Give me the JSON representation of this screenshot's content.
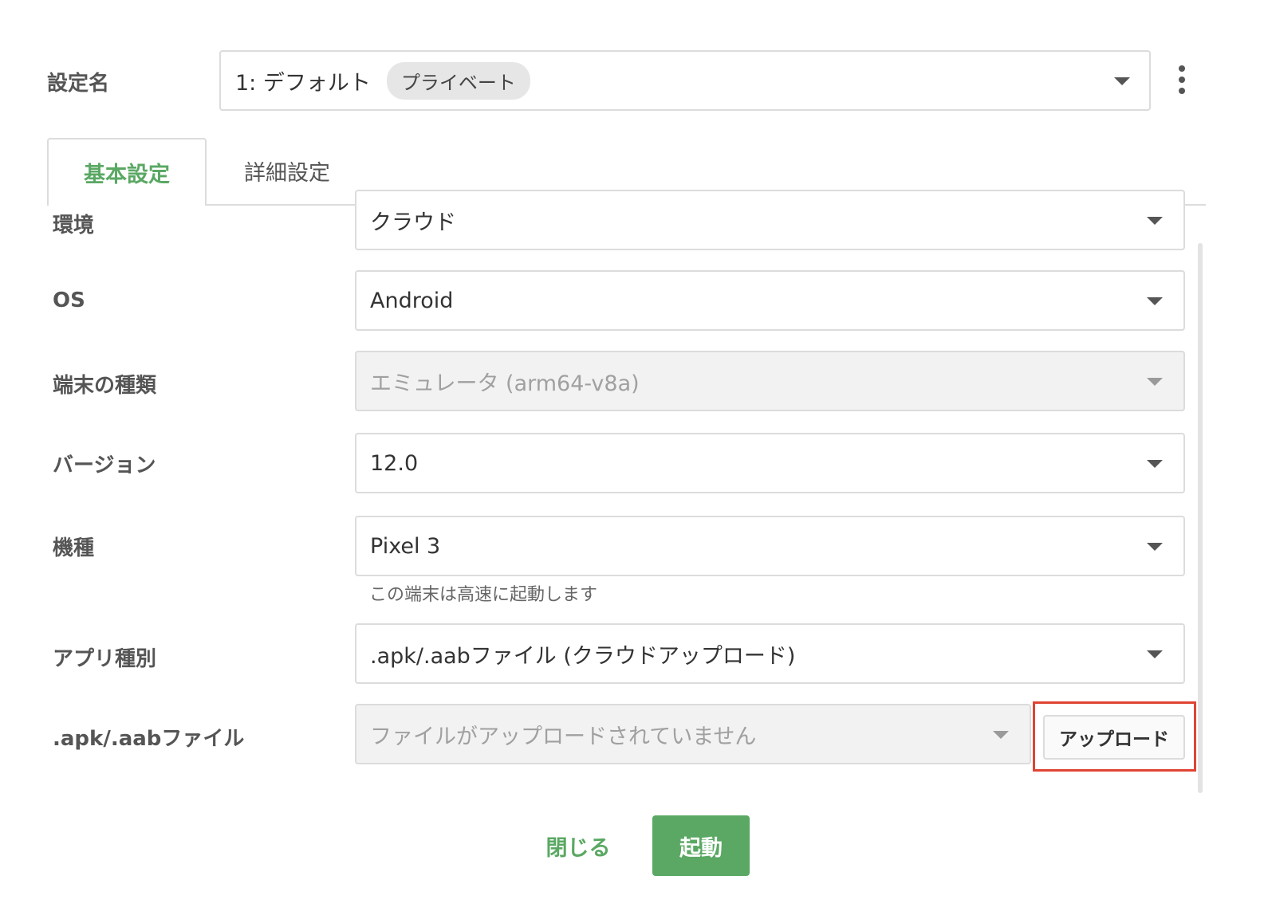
{
  "setting": {
    "label": "設定名",
    "value": "1: デフォルト",
    "badge": "プライベート"
  },
  "tabs": [
    {
      "label": "基本設定",
      "active": true
    },
    {
      "label": "詳細設定",
      "active": false
    }
  ],
  "form": {
    "environment": {
      "label": "環境",
      "value": "クラウド"
    },
    "os": {
      "label": "OS",
      "value": "Android"
    },
    "device_type": {
      "label": "端末の種類",
      "value": "エミュレータ (arm64-v8a)"
    },
    "version": {
      "label": "バージョン",
      "value": "12.0"
    },
    "model": {
      "label": "機種",
      "value": "Pixel 3",
      "hint": "この端末は高速に起動します"
    },
    "app_type": {
      "label": "アプリ種別",
      "value": ".apk/.aabファイル (クラウドアップロード)"
    },
    "app_file": {
      "label": ".apk/.aabファイル",
      "placeholder": "ファイルがアップロードされていません",
      "upload_label": "アップロード"
    }
  },
  "footer": {
    "close_label": "閉じる",
    "launch_label": "起動"
  },
  "colors": {
    "accent": "#5aa863",
    "highlight": "#e04434"
  }
}
